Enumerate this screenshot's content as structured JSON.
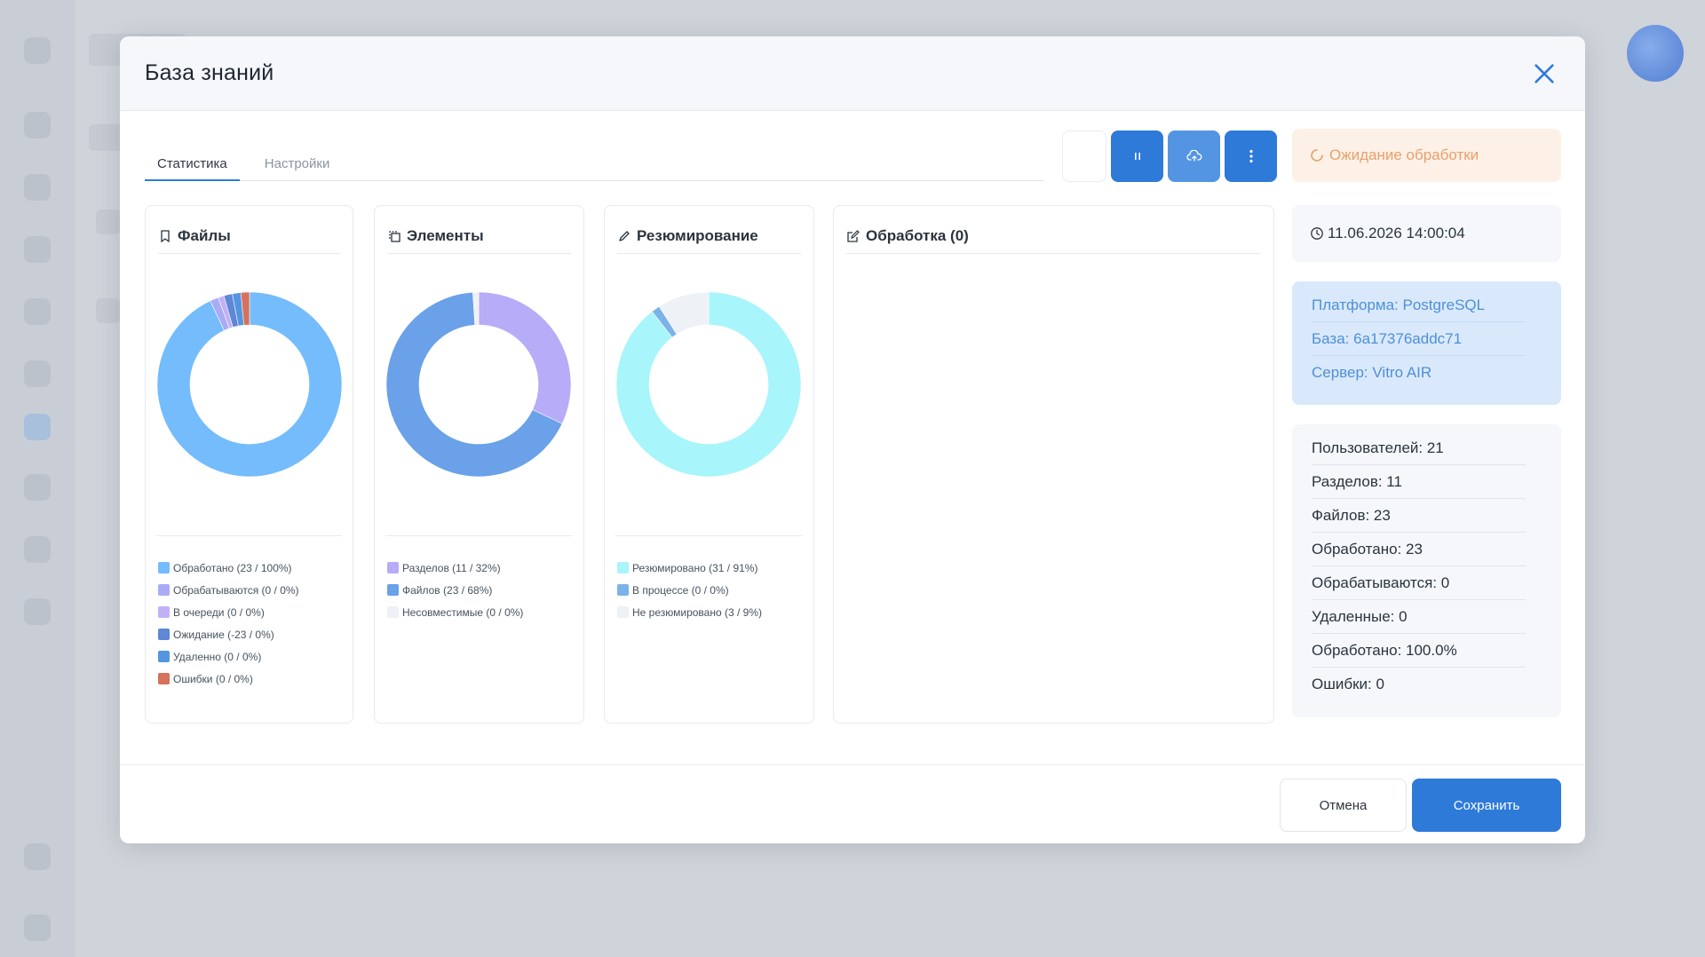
{
  "modal": {
    "title": "База знаний",
    "close_icon": "close-icon"
  },
  "tabs": [
    {
      "label": "Статистика",
      "active": true
    },
    {
      "label": "Настройки",
      "active": false
    }
  ],
  "toolbar": {
    "buttons": [
      {
        "icon": "blank",
        "style": "ghost"
      },
      {
        "icon": "pause-icon",
        "style": "blue"
      },
      {
        "icon": "cloud-icon",
        "style": "blue-light"
      },
      {
        "icon": "more-vertical-icon",
        "style": "blue"
      }
    ]
  },
  "status": {
    "label": "Ожидание обработки",
    "icon": "spinner-icon",
    "color": "#e7a06a"
  },
  "cards": {
    "files": {
      "title": "Файлы",
      "icon": "bookmark-icon"
    },
    "elements": {
      "title": "Элементы",
      "icon": "copy-icon"
    },
    "summary": {
      "title": "Резюмирование",
      "icon": "pencil-icon"
    },
    "processing": {
      "title": "Обработка (0)",
      "icon": "edit-icon"
    }
  },
  "chart_data": [
    {
      "type": "pie",
      "title": "Файлы",
      "slices": [
        {
          "label": "Обработано (23 / 100%)",
          "value": 93.0,
          "color": "#74bcfc"
        },
        {
          "label": "Обрабатываются (0 / 0%)",
          "value": 1.5,
          "color": "#a9acf5"
        },
        {
          "label": "В очереди (0 / 0%)",
          "value": 1.0,
          "color": "#c2b0f7"
        },
        {
          "label": "Ожидание (-23 / 0%)",
          "value": 1.5,
          "color": "#5f87d6"
        },
        {
          "label": "Удаленно (0 / 0%)",
          "value": 1.5,
          "color": "#5595e0"
        },
        {
          "label": "Ошибки (0 / 0%)",
          "value": 1.5,
          "color": "#d4725e"
        }
      ]
    },
    {
      "type": "pie",
      "title": "Элементы",
      "slices": [
        {
          "label": "Разделов (11 / 32%)",
          "value": 32,
          "color": "#b7acf8"
        },
        {
          "label": "Файлов (23 / 68%)",
          "value": 67,
          "color": "#6aa1e8"
        },
        {
          "label": "Несовместимые (0 / 0%)",
          "value": 1,
          "color": "#eef1f5"
        }
      ]
    },
    {
      "type": "pie",
      "title": "Резюмирование",
      "slices": [
        {
          "label": "Резюмировано (31 / 91%)",
          "value": 89.5,
          "color": "#a8f5fb"
        },
        {
          "label": "В процессе (0 / 0%)",
          "value": 1.5,
          "color": "#7bb3e8"
        },
        {
          "label": "Не резюмировано (3 / 9%)",
          "value": 9,
          "color": "#eef1f5"
        }
      ]
    }
  ],
  "info": {
    "date": "11.06.2026 14:00:04",
    "db": [
      "Платформа: PostgreSQL",
      "База: 6a17376addc71",
      "Сервер: Vitro AIR"
    ],
    "stats": [
      "Пользователей: 21",
      "Разделов: 11",
      "Файлов: 23",
      "Обработано: 23",
      "Обрабатываются: 0",
      "Удаленные: 0",
      "Обработано: 100.0%",
      "Ошибки: 0"
    ]
  },
  "footer": {
    "cancel_label": "Отмена",
    "save_label": "Сохранить"
  }
}
